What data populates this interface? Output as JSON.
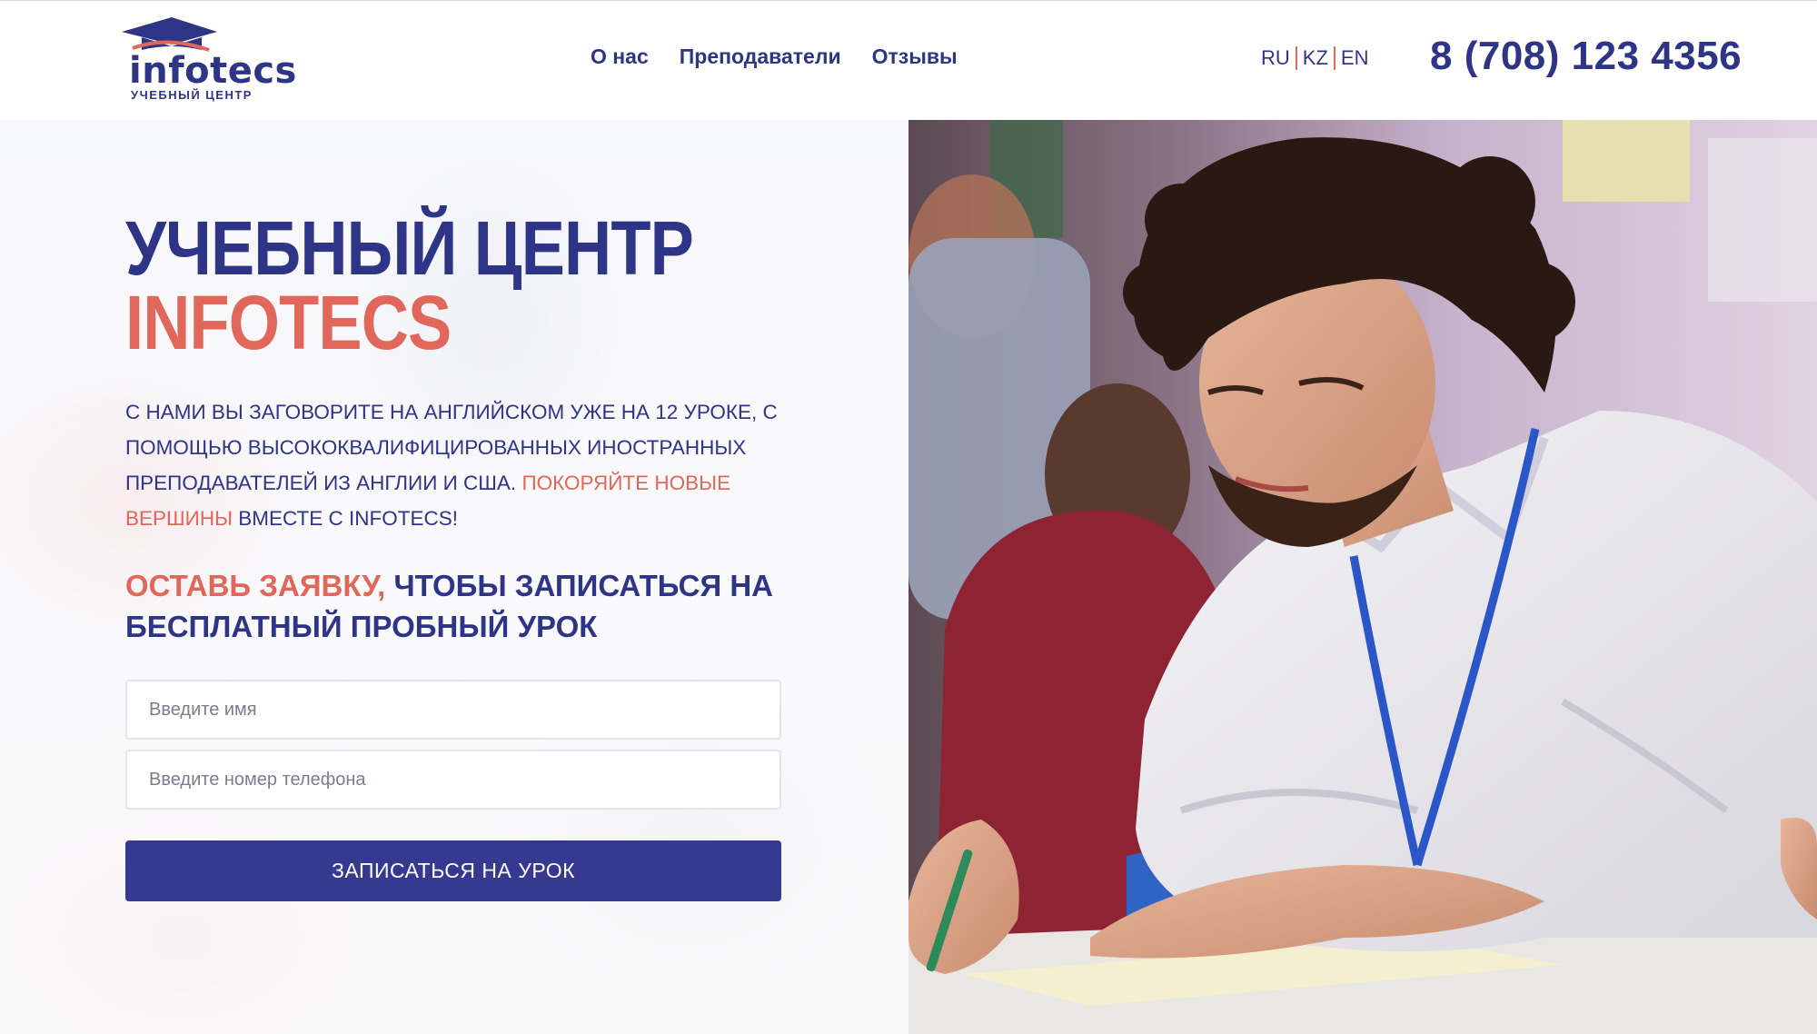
{
  "header": {
    "logo": {
      "word": "infotecs",
      "subtitle": "УЧЕБНЫЙ ЦЕНТР"
    },
    "nav": [
      "О нас",
      "Преподаватели",
      "Отзывы"
    ],
    "languages": [
      "RU",
      "KZ",
      "EN"
    ],
    "phone": "8 (708) 123 4356"
  },
  "hero": {
    "title_line1": "УЧЕБНЫЙ ЦЕНТР",
    "title_line2": "INFOTECS",
    "description_main": "С нами вы заговорите на английском уже на 12 уроке, с помощью высококвалифицированных иностранных преподавателей из Англии и США.",
    "description_accent": "Покоряйте новые вершины",
    "description_tail": " вместе с INFOTECS!",
    "cta_accent": "ОСТАВЬ ЗАЯВКУ,",
    "cta_rest": " ЧТОБЫ ЗАПИСАТЬСЯ НА БЕСПЛАТНЫЙ ПРОБНЫЙ УРОК",
    "form": {
      "name_placeholder": "Введите имя",
      "phone_placeholder": "Введите номер телефона",
      "submit_label": "ЗАПИСАТЬСЯ НА УРОК"
    }
  },
  "colors": {
    "brand_blue": "#2e3586",
    "accent_coral": "#e1675a",
    "button_blue": "#35398f"
  }
}
